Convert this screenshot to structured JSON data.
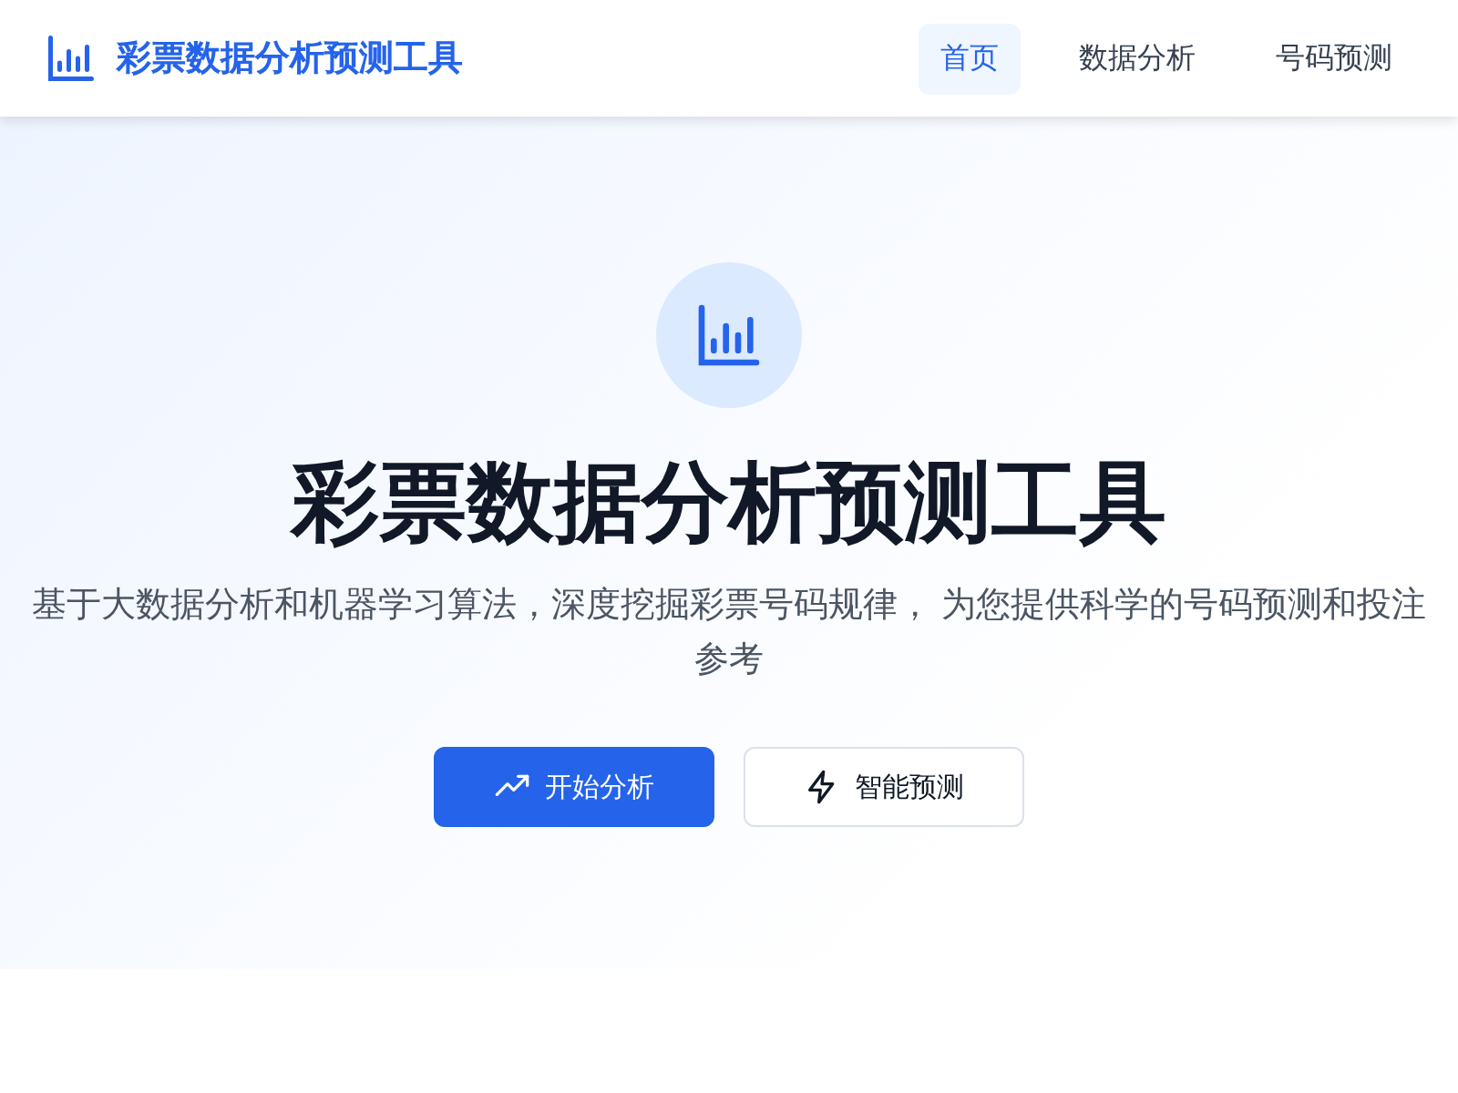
{
  "header": {
    "title": "彩票数据分析预测工具",
    "nav": [
      {
        "label": "首页",
        "selected": true
      },
      {
        "label": "数据分析",
        "selected": false
      },
      {
        "label": "号码预测",
        "selected": false
      }
    ]
  },
  "hero": {
    "title": "彩票数据分析预测工具",
    "subtitle": "基于大数据分析和机器学习算法，深度挖掘彩票号码规律， 为您提供科学的号码预测和投注参考",
    "buttons": [
      {
        "label": "开始分析",
        "kind": "primary"
      },
      {
        "label": "智能预测",
        "kind": "secondary"
      }
    ]
  }
}
